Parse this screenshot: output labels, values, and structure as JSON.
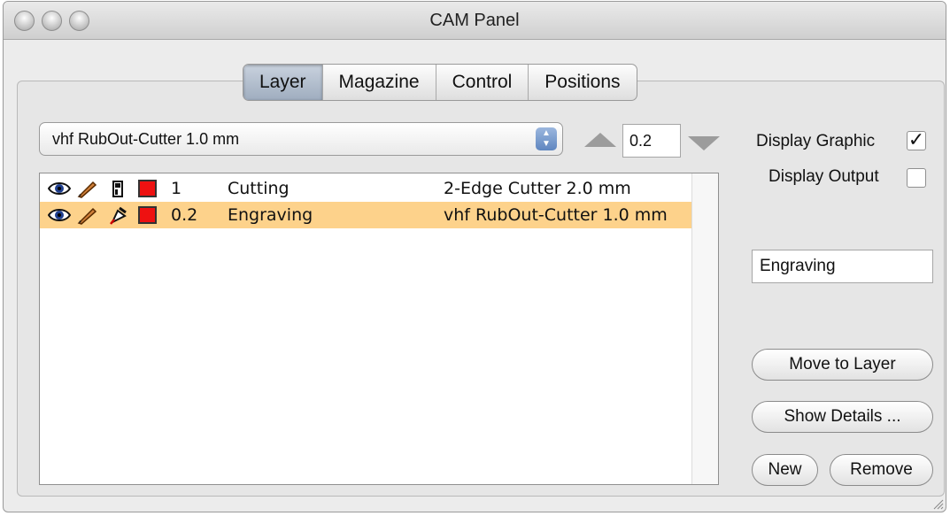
{
  "window": {
    "title": "CAM Panel"
  },
  "tabs": [
    {
      "label": "Layer",
      "active": true
    },
    {
      "label": "Magazine",
      "active": false
    },
    {
      "label": "Control",
      "active": false
    },
    {
      "label": "Positions",
      "active": false
    }
  ],
  "tool_select": {
    "value": "vhf RubOut-Cutter 1.0 mm"
  },
  "depth_stepper": {
    "value": "0.2"
  },
  "layers": [
    {
      "value": "1",
      "name": "Cutting",
      "tool": "2-Edge Cutter 2.0 mm",
      "selected": false,
      "color": "#e11"
    },
    {
      "value": "0.2",
      "name": "Engraving",
      "tool": "vhf RubOut-Cutter 1.0 mm",
      "selected": true,
      "color": "#e11"
    }
  ],
  "options": {
    "display_graphic": {
      "label": "Display Graphic",
      "checked": true,
      "mark": "✓"
    },
    "display_output": {
      "label": "Display Output",
      "checked": false
    }
  },
  "layer_name_field": {
    "value": "Engraving"
  },
  "buttons": {
    "move_to_layer": "Move to Layer",
    "show_details": "Show Details ...",
    "new": "New",
    "remove": "Remove"
  },
  "colors": {
    "selection": "#fdd28b",
    "tab_active": "#b3c0d0",
    "swatch": "#e11"
  }
}
